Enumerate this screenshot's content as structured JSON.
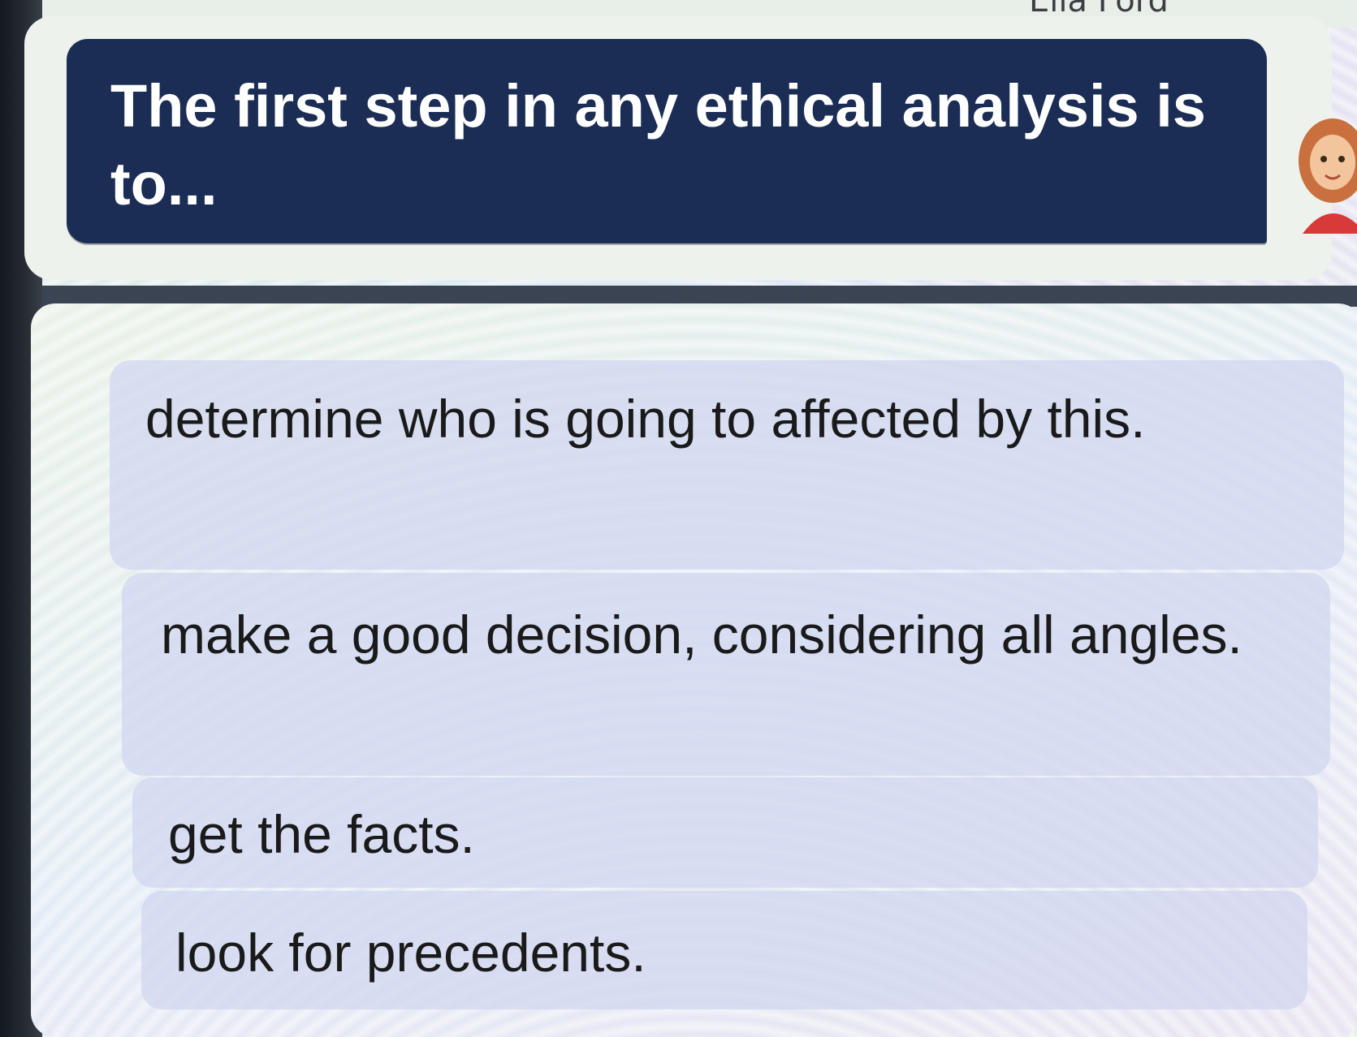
{
  "header": {
    "partial_name": "Ella Ford"
  },
  "question": {
    "text": "The first step in any ethical analysis is to..."
  },
  "answers": [
    {
      "label": "determine who is going to affected by this."
    },
    {
      "label": "make a good decision, considering all angles."
    },
    {
      "label": "get the facts."
    },
    {
      "label": "look for precedents."
    }
  ],
  "colors": {
    "question_bg": "#1b2d55",
    "question_text": "#ffffff",
    "answer_bg": "#d0d6f0"
  },
  "icons": {
    "avatar": "character-avatar-icon"
  }
}
